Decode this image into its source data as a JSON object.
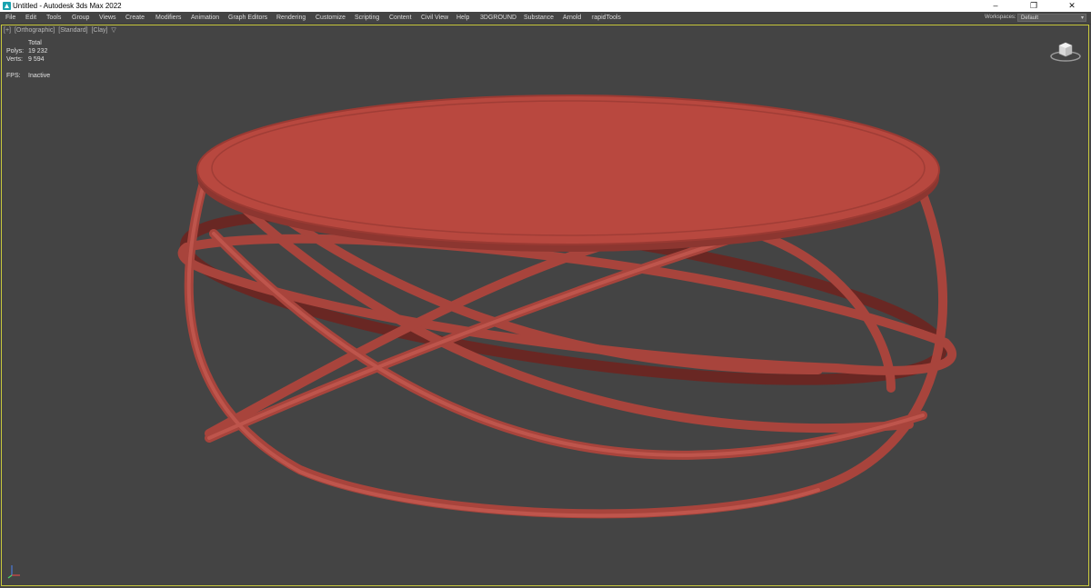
{
  "window": {
    "title": "Untitled - Autodesk 3ds Max 2022",
    "controls": {
      "minimize": "–",
      "maximize": "❐",
      "close": "✕"
    }
  },
  "menu": [
    "File",
    "Edit",
    "Tools",
    "Group",
    "Views",
    "Create",
    "Modifiers",
    "Animation",
    "Graph Editors",
    "Rendering",
    "Customize",
    "Scripting",
    "Content",
    "Civil View",
    "Help",
    "3DGROUND",
    "Substance",
    "Arnold",
    "rapidTools"
  ],
  "workspace": {
    "label": "Workspaces:",
    "value": "Default"
  },
  "viewport": {
    "label": [
      "[+]",
      "[Orthographic]",
      "[Standard]",
      "[Clay]"
    ],
    "filter_icon": "funnel-icon",
    "stats": {
      "header": "Total",
      "polys_label": "Polys:",
      "polys_value": "19 232",
      "verts_label": "Verts:",
      "verts_value": "9 594",
      "fps_label": "FPS:",
      "fps_value": "Inactive"
    },
    "model_color": "#b5473f",
    "background_color": "#444444",
    "active_border_color": "#c8c83c"
  }
}
